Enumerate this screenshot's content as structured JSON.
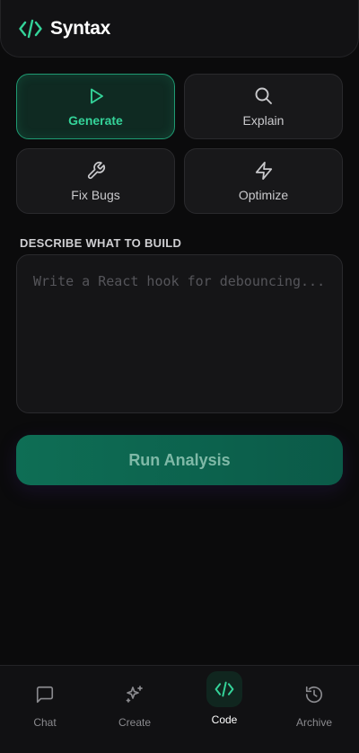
{
  "app": {
    "title": "Syntax"
  },
  "colors": {
    "accent": "#34d399",
    "background": "#0b0b0c",
    "card": "#18181a",
    "button": "#0e6e55"
  },
  "modes": [
    {
      "label": "Generate",
      "icon": "play-icon",
      "active": true
    },
    {
      "label": "Explain",
      "icon": "search-icon",
      "active": false
    },
    {
      "label": "Fix Bugs",
      "icon": "wrench-icon",
      "active": false
    },
    {
      "label": "Optimize",
      "icon": "lightning-icon",
      "active": false
    }
  ],
  "prompt": {
    "label": "DESCRIBE WHAT TO BUILD",
    "value": "",
    "placeholder": "Write a React hook for debouncing..."
  },
  "run_button": {
    "label": "Run Analysis"
  },
  "nav": [
    {
      "label": "Chat",
      "icon": "chat-icon",
      "active": false
    },
    {
      "label": "Create",
      "icon": "sparkles-icon",
      "active": false
    },
    {
      "label": "Code",
      "icon": "code-icon",
      "active": true
    },
    {
      "label": "Archive",
      "icon": "history-icon",
      "active": false
    }
  ]
}
